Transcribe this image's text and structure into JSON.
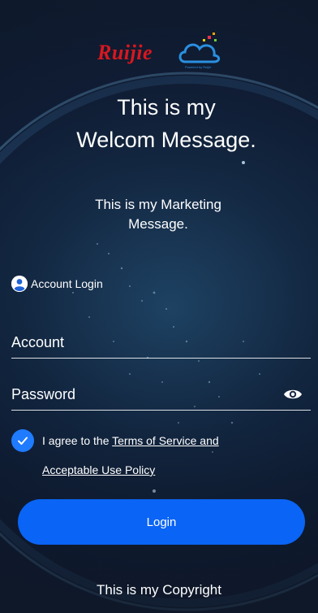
{
  "brand": {
    "logo_text": "Ruijie",
    "logo_color": "#d8171f",
    "cloud_color": "#2a8fe0"
  },
  "welcome": {
    "line1": "This is my",
    "line2": "Welcom Message."
  },
  "marketing": {
    "line1": "This is my Marketing",
    "line2": "Message."
  },
  "login_section": {
    "label": "Account Login",
    "icon": "user-circle-icon"
  },
  "form": {
    "account_placeholder": "Account",
    "account_value": "",
    "password_placeholder": "Password",
    "password_value": "",
    "password_toggle_icon": "eye-icon"
  },
  "agreement": {
    "checked": true,
    "prefix": "I agree to the ",
    "link_part1": "Terms of Service and",
    "link_part2": "Acceptable Use Policy",
    "check_color": "#1f7bff"
  },
  "actions": {
    "login_label": "Login",
    "login_color": "#0a64f5"
  },
  "footer": {
    "copyright": "This is my Copyright"
  }
}
